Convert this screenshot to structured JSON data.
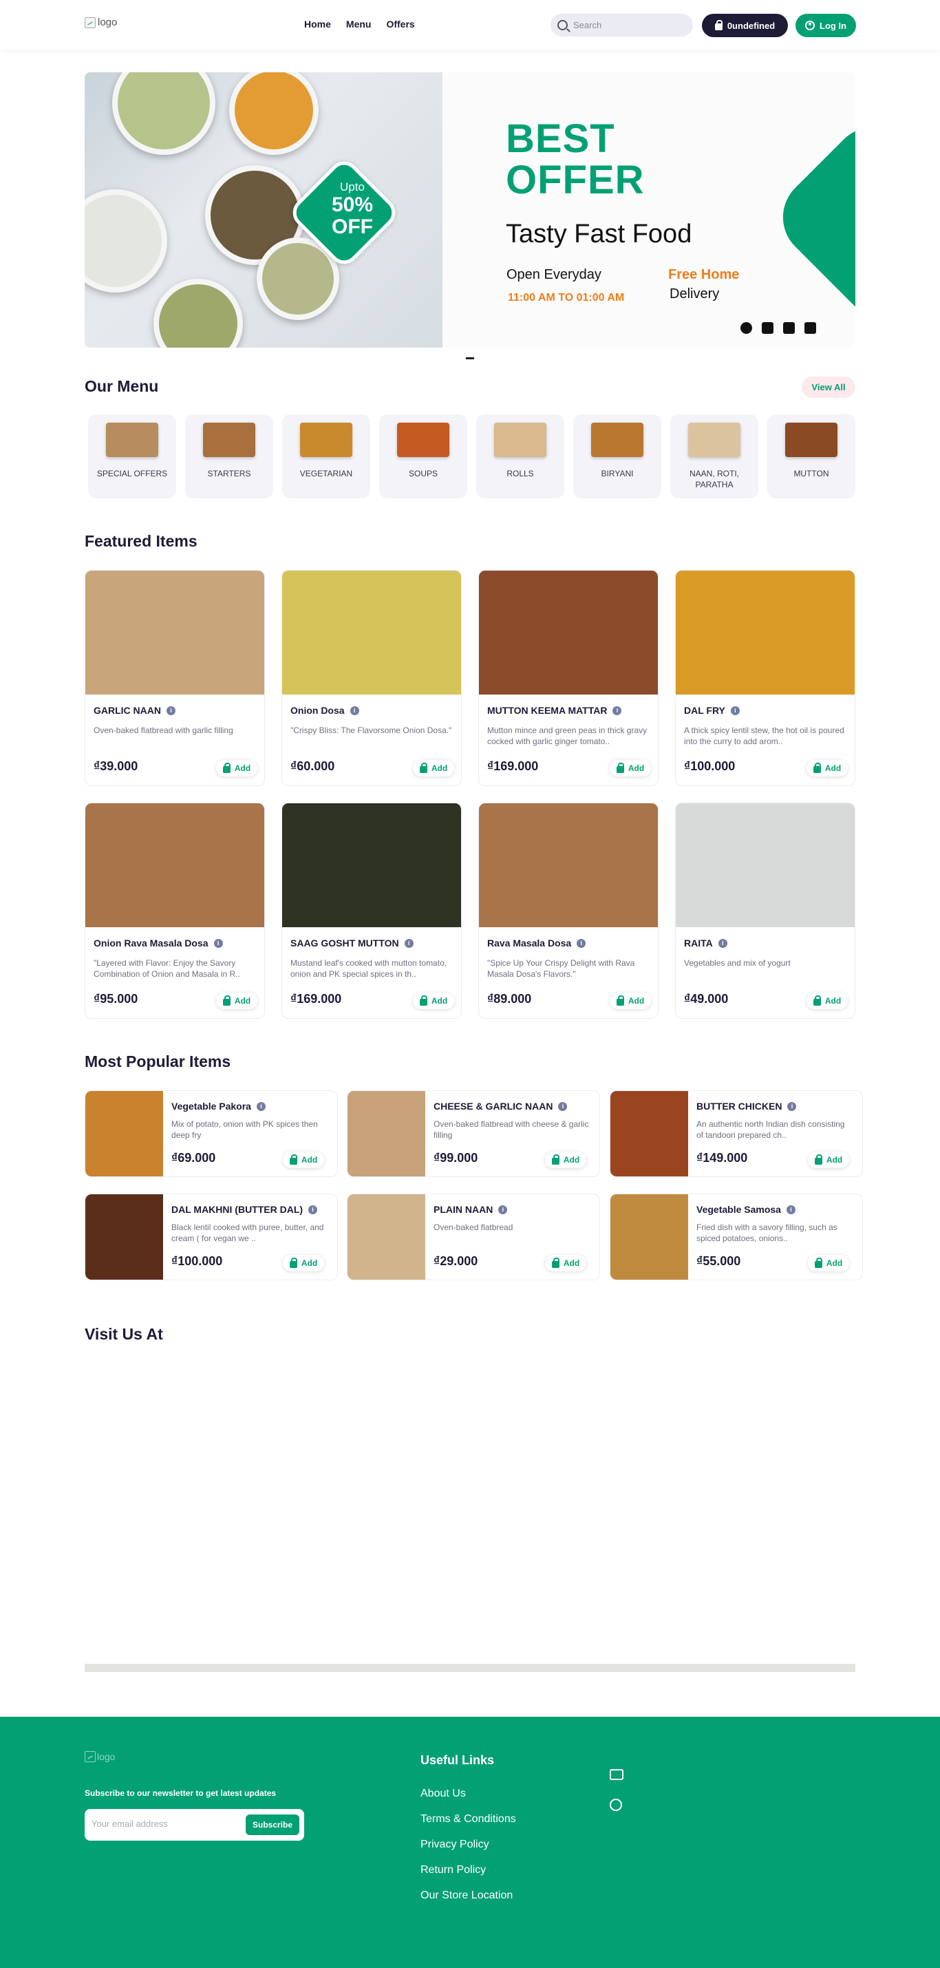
{
  "header": {
    "logo_alt": "logo",
    "nav": [
      "Home",
      "Menu",
      "Offers"
    ],
    "search_placeholder": "Search",
    "cart_label": "0undefined",
    "login_label": "Log In"
  },
  "banner": {
    "promo_upto": "Upto",
    "promo_pct": "50%",
    "promo_off": "OFF",
    "headline_1": "BEST",
    "headline_2": "OFFER",
    "subtitle": "Tasty Fast Food",
    "open": "Open Everyday",
    "hours": "11:00 AM TO 01:00 AM",
    "free_home": "Free Home",
    "delivery": "Delivery"
  },
  "menu": {
    "title": "Our Menu",
    "view_all": "View All",
    "categories": [
      {
        "label": "SPECIAL OFFERS",
        "color": "#b78c5e"
      },
      {
        "label": "STARTERS",
        "color": "#a7703c"
      },
      {
        "label": "VEGETARIAN",
        "color": "#c98a2e"
      },
      {
        "label": "SOUPS",
        "color": "#c45a21"
      },
      {
        "label": "ROLLS",
        "color": "#d9b98d"
      },
      {
        "label": "BIRYANI",
        "color": "#b9772e"
      },
      {
        "label": "NAAN, ROTI, PARATHA",
        "color": "#dac39d"
      },
      {
        "label": "MUTTON",
        "color": "#8a4a24"
      }
    ]
  },
  "featured": {
    "title": "Featured Items",
    "add_label": "Add",
    "items": [
      {
        "name": "GARLIC NAAN",
        "desc": "Oven-baked flatbread with garlic filling",
        "price": "₫39.000",
        "color": "#c8a57a"
      },
      {
        "name": "Onion Dosa",
        "desc": "\"Crispy Bliss: The Flavorsome Onion Dosa.\"",
        "price": "₫60.000",
        "color": "#d4c45a"
      },
      {
        "name": "MUTTON KEEMA MATTAR",
        "desc": "Mutton mince and green peas in thick gravy cocked with garlic ginger tomato..",
        "price": "₫169.000",
        "color": "#8b4a2a"
      },
      {
        "name": "DAL FRY",
        "desc": "A thick spicy lentil stew, the hot oil is poured into the curry to add arom..",
        "price": "₫100.000",
        "color": "#d99a26"
      },
      {
        "name": "Onion Rava Masala Dosa",
        "desc": "\"Layered with Flavor: Enjoy the Savory Combination of Onion and Masala in R..",
        "price": "₫95.000",
        "color": "#a9744a"
      },
      {
        "name": "SAAG GOSHT MUTTON",
        "desc": "Mustand leaf's cooked with mutton tomato, onion and PK special spices in th..",
        "price": "₫169.000",
        "color": "#2e3324"
      },
      {
        "name": "Rava Masala Dosa",
        "desc": "\"Spice Up Your Crispy Delight with Rava Masala Dosa's Flavors.\"",
        "price": "₫89.000",
        "color": "#a9744a"
      },
      {
        "name": "RAITA",
        "desc": "Vegetables and mix of yogurt",
        "price": "₫49.000",
        "color": "#d7dad8"
      }
    ]
  },
  "popular": {
    "title": "Most Popular Items",
    "add_label": "Add",
    "items": [
      {
        "name": "Vegetable Pakora",
        "desc": "Mix of potato, onion with PK spices then deep fry",
        "price": "₫69.000",
        "color": "#c9822d"
      },
      {
        "name": "CHEESE & GARLIC NAAN",
        "desc": "Oven-baked flatbread with cheese & garlic filling",
        "price": "₫99.000",
        "color": "#c7a27a"
      },
      {
        "name": "BUTTER CHICKEN",
        "desc": "An authentic north Indian dish consisting of tandoori prepared ch..",
        "price": "₫149.000",
        "color": "#9b4420"
      },
      {
        "name": "DAL MAKHNI (BUTTER DAL)",
        "desc": "Black lentil cooked with puree, butter, and cream ( for vegan we ..",
        "price": "₫100.000",
        "color": "#5b2e1b"
      },
      {
        "name": "PLAIN NAAN",
        "desc": "Oven-baked flatbread",
        "price": "₫29.000",
        "color": "#d2b48c"
      },
      {
        "name": "Vegetable Samosa",
        "desc": "Fried dish with a savory filling, such as spiced potatoes, onions..",
        "price": "₫55.000",
        "color": "#c08a3e"
      }
    ]
  },
  "visit": {
    "title": "Visit Us At"
  },
  "footer": {
    "logo_alt": "logo",
    "newsletter_label": "Subscribe to our newsletter to get latest updates",
    "email_placeholder": "Your email address",
    "subscribe_label": "Subscribe",
    "links_title": "Useful Links",
    "links": [
      "About Us",
      "Terms & Conditions",
      "Privacy Policy",
      "Return Policy",
      "Our Store Location"
    ]
  }
}
